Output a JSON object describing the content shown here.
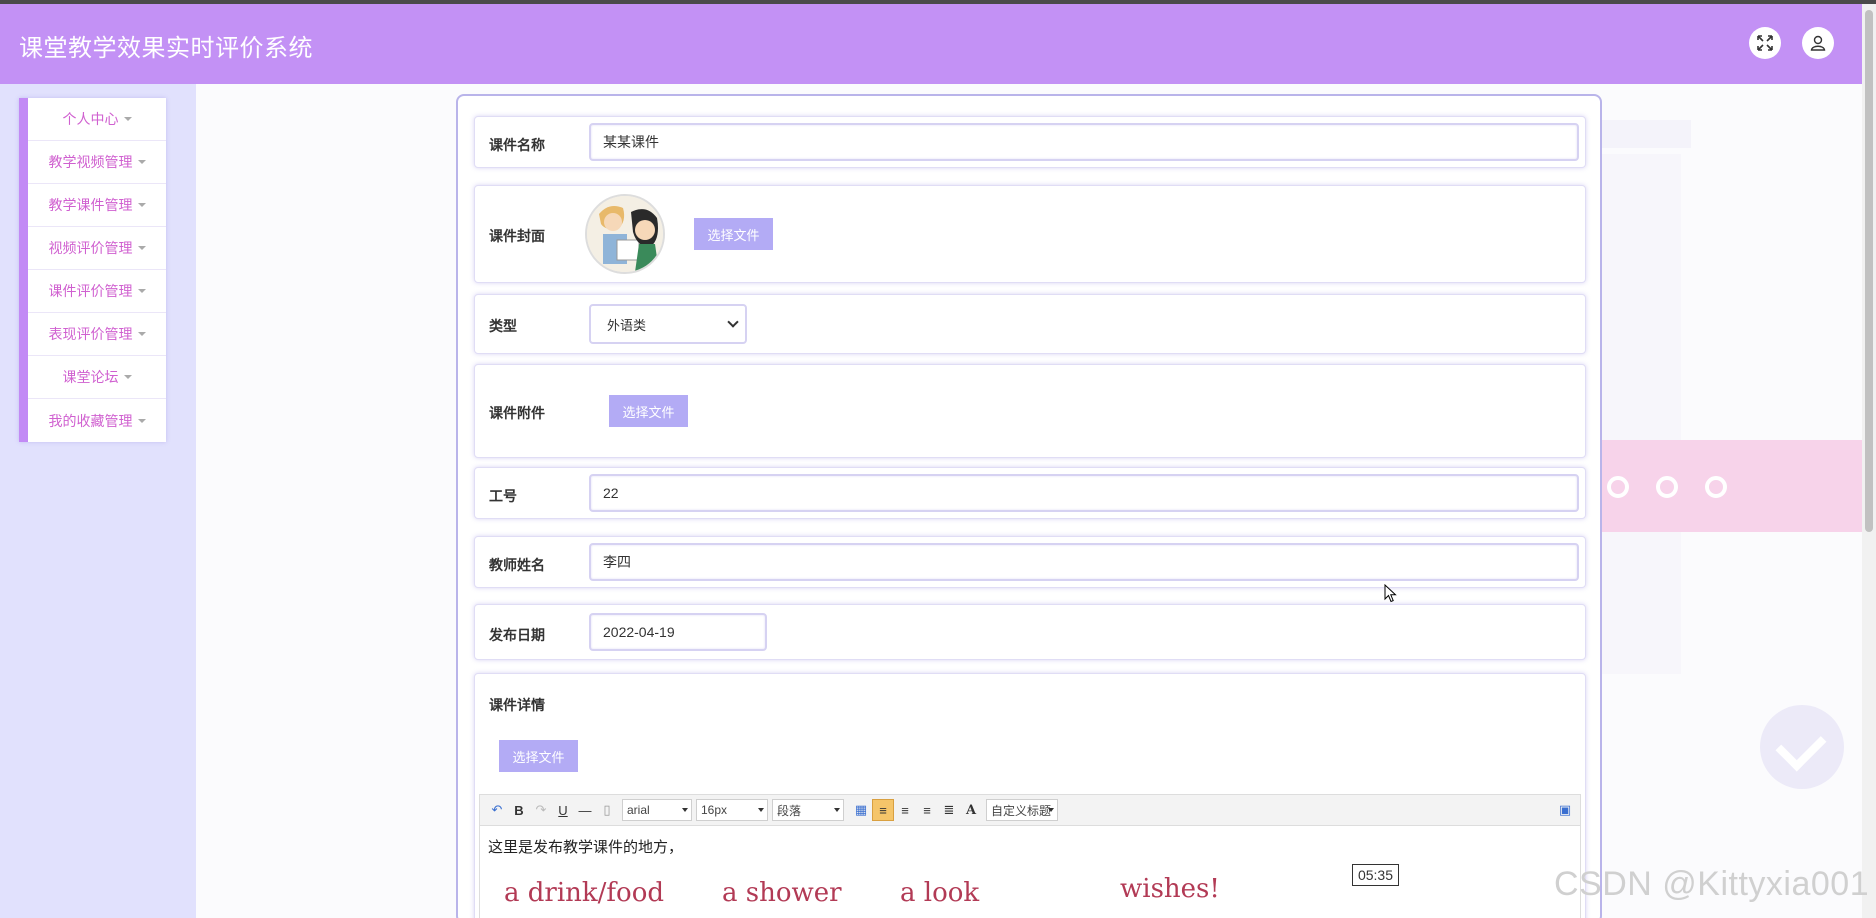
{
  "app": {
    "title": "课堂教学效果实时评价系统"
  },
  "header": {
    "fullscreen_icon": "expand-icon",
    "user_icon": "user-icon"
  },
  "sidebar": {
    "items": [
      {
        "label": "个人中心"
      },
      {
        "label": "教学视频管理"
      },
      {
        "label": "教学课件管理"
      },
      {
        "label": "视频评价管理"
      },
      {
        "label": "课件评价管理"
      },
      {
        "label": "表现评价管理"
      },
      {
        "label": "课堂论坛"
      },
      {
        "label": "我的收藏管理"
      }
    ]
  },
  "form": {
    "courseware_name": {
      "label": "课件名称",
      "value": "某某课件"
    },
    "cover": {
      "label": "课件封面",
      "button": "选择文件"
    },
    "type": {
      "label": "类型",
      "selected": "外语类"
    },
    "attachment": {
      "label": "课件附件",
      "button": "选择文件"
    },
    "job_number": {
      "label": "工号",
      "value": "22"
    },
    "teacher_name": {
      "label": "教师姓名",
      "value": "李四"
    },
    "publish_date": {
      "label": "发布日期",
      "value": "2022-04-19"
    },
    "details": {
      "label": "课件详情",
      "button": "选择文件",
      "toolbar": {
        "font": "arial",
        "size": "16px",
        "paragraph": "段落",
        "custom_title": "自定义标题"
      },
      "content_text": "这里是发布教学课件的地方，",
      "image_words": [
        "a drink/food",
        "a shower",
        "a look",
        "wishes!"
      ]
    }
  },
  "overlay": {
    "timer": "05:35",
    "watermark": "CSDN @Kittyxia001"
  },
  "colors": {
    "header": "#c391f5",
    "sidebar_bg": "#e1e1fd",
    "accent": "#b3abf5",
    "menu_text": "#d060d0"
  }
}
